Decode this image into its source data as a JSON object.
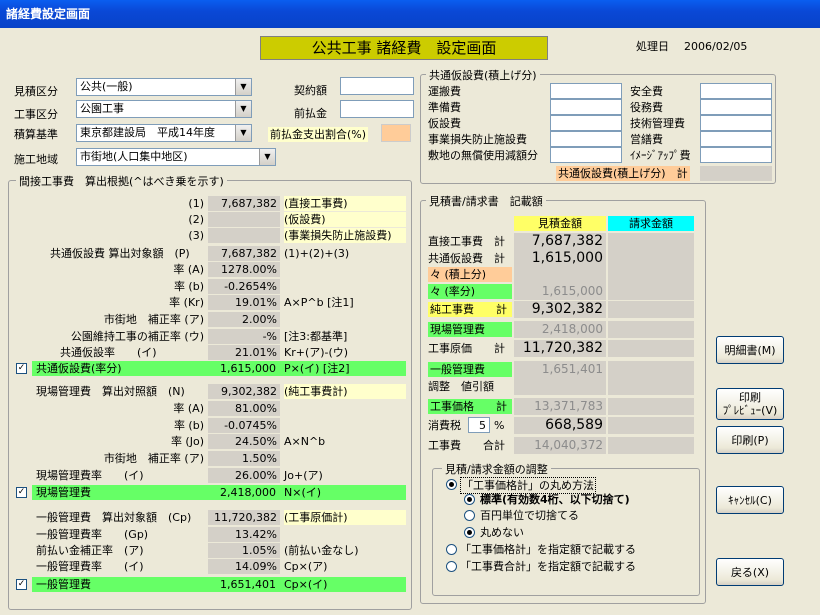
{
  "window": {
    "title": "諸経費設定画面"
  },
  "header": {
    "title": "公共工事 諸経費　設定画面",
    "date_label": "処理日",
    "date": "2006/02/05"
  },
  "form": {
    "mitsumori_kubun": {
      "label": "見積区分",
      "value": "公共(一般)"
    },
    "koji_kubun": {
      "label": "工事区分",
      "value": "公園工事"
    },
    "sekisan_kijun": {
      "label": "積算基準",
      "value": "東京都建設局　平成14年度"
    },
    "sekou_chiiki": {
      "label": "施工地域",
      "value": "市街地(人口集中地区)"
    },
    "keiyaku_gaku": {
      "label": "契約額",
      "value": ""
    },
    "maebarai": {
      "label": "前払金",
      "value": ""
    },
    "maebarai_ratio": {
      "label": "前払金支出割合(%)",
      "value": ""
    }
  },
  "kyotsu_tsumiage": {
    "title": "共通仮設費(積上げ分)",
    "left": [
      {
        "label": "運搬費",
        "value": ""
      },
      {
        "label": "準備費",
        "value": ""
      },
      {
        "label": "仮設費",
        "value": ""
      },
      {
        "label": "事業損失防止施設費",
        "value": ""
      },
      {
        "label": "敷地の無償使用減額分",
        "value": ""
      }
    ],
    "right": [
      {
        "label": "安全費",
        "value": ""
      },
      {
        "label": "役務費",
        "value": ""
      },
      {
        "label": "技術管理費",
        "value": ""
      },
      {
        "label": "営繕費",
        "value": ""
      },
      {
        "label": "ｲﾒｰｼﾞｱｯﾌﾟ費",
        "value": ""
      }
    ],
    "total_label": "共通仮設費(積上げ分)　計",
    "total_value": ""
  },
  "kansetsu": {
    "title": "間接工事費　算出根拠(^はべき乗を示す)",
    "rows": [
      {
        "label": "(1)",
        "value": "7,687,382",
        "note": "(直接工事費)"
      },
      {
        "label": "(2)",
        "value": "",
        "note": "(仮設費)"
      },
      {
        "label": "(3)",
        "value": "",
        "note": "(事業損失防止施設費)"
      },
      {
        "label": "共通仮設費 算出対象額　(P)",
        "value": "7,687,382",
        "note": "(1)+(2)+(3)"
      },
      {
        "label": "率 (A)",
        "value": "1278.00%",
        "note": ""
      },
      {
        "label": "率 (b)",
        "value": "-0.2654%",
        "note": ""
      },
      {
        "label": "率 (Kr)",
        "value": "19.01%",
        "note": "A×P^b [注1]"
      },
      {
        "label": "市街地　補正率 (ア)",
        "value": "2.00%",
        "note": ""
      },
      {
        "label": "公園維持工事の補正率 (ウ)",
        "value": "-%",
        "note": "[注3:都基準]"
      },
      {
        "label": "共通仮設率　　(イ)",
        "value": "21.01%",
        "note": "Kr+(ア)-(ウ)"
      }
    ],
    "kyotsu_total": {
      "label": "共通仮設費(率分)",
      "value": "1,615,000",
      "note": "P×(イ) [注2]"
    },
    "genba_rows": [
      {
        "label": "現場管理費　算出対照額　(N)",
        "value": "9,302,382",
        "note": "(純工事費計)"
      },
      {
        "label": "率 (A)",
        "value": "81.00%",
        "note": ""
      },
      {
        "label": "率 (b)",
        "value": "-0.0745%",
        "note": ""
      },
      {
        "label": "率 (Jo)",
        "value": "24.50%",
        "note": "A×N^b"
      },
      {
        "label": "市街地　補正率 (ア)",
        "value": "1.50%",
        "note": ""
      },
      {
        "label": "現場管理費率　　(イ)",
        "value": "26.00%",
        "note": "Jo+(ア)"
      }
    ],
    "genba_total": {
      "label": "現場管理費",
      "value": "2,418,000",
      "note": "N×(イ)"
    },
    "ippan_rows": [
      {
        "label": "一般管理費　算出対象額　(Cp)",
        "value": "11,720,382",
        "note": "(工事原価計)"
      },
      {
        "label": "一般管理費率　　(Gp)",
        "value": "13.42%",
        "note": ""
      },
      {
        "label": "前払い金補正率　(ア)",
        "value": "1.05%",
        "note": "(前払い金なし)"
      },
      {
        "label": "一般管理費率　　(イ)",
        "value": "14.09%",
        "note": "Cp×(ア)"
      }
    ],
    "ippan_total": {
      "label": "一般管理費",
      "value": "1,651,401",
      "note": "Cp×(イ)"
    }
  },
  "mitsumorisho": {
    "title": "見積書/請求書　記載額",
    "col1": "見積金額",
    "col2": "請求金額",
    "rows": [
      {
        "label": "直接工事費　計",
        "value": "7,687,382",
        "dim": false
      },
      {
        "label": "共通仮設費　計",
        "value": "1,615,000",
        "dim": false
      },
      {
        "label": "々 (積上分)",
        "value": "",
        "dim": false
      },
      {
        "label": "々 (率分)",
        "value": "1,615,000",
        "dim": true
      },
      {
        "label": "純工事費　　計",
        "value": "9,302,382",
        "dim": false
      },
      {
        "label": "現場管理費",
        "value": "2,418,000",
        "dim": true
      },
      {
        "label": "工事原価　　計",
        "value": "11,720,382",
        "dim": false
      },
      {
        "label": "一般管理費",
        "value": "1,651,401",
        "dim": true
      },
      {
        "label": "調整　値引額",
        "value": "",
        "dim": false
      },
      {
        "label": "工事価格　　計",
        "value": "13,371,783",
        "dim": true
      },
      {
        "label": "消費税",
        "value": "668,589",
        "dim": false
      },
      {
        "label": "工事費　　合計",
        "value": "14,040,372",
        "dim": true
      }
    ],
    "tax_rate": "5",
    "tax_unit": "%"
  },
  "adjust": {
    "title": "見積/請求金額の調整",
    "opt1": "「工事価格計」の丸め方法",
    "sub1": "標準(有効数4桁、以下切捨て)",
    "sub2": "百円単位で切捨てる",
    "sub3": "丸めない",
    "opt2": "「工事価格計」を指定額で記載する",
    "opt3": "「工事費合計」を指定額で記載する"
  },
  "buttons": {
    "meisai": "明細書(M)",
    "print_preview_1": "印刷",
    "print_preview_2": "ﾌﾟﾚﾋﾞｭｰ(V)",
    "print": "印刷(P)",
    "cancel": "ｷｬﾝｾﾙ(C)",
    "back": "戻る(X)"
  },
  "colors": {
    "yellow_header": "#ffff66",
    "green_row": "#66ff66",
    "cyan_header": "#00ffff",
    "orange": "#ffcc99"
  }
}
